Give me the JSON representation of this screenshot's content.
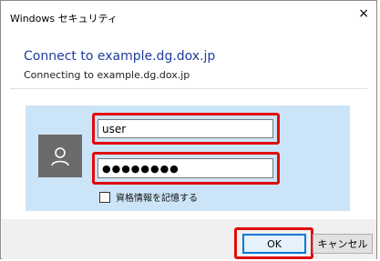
{
  "window": {
    "title": "Windows セキュリティ",
    "close_glyph": "×"
  },
  "header": {
    "heading": "Connect to example.dg.dox.jp",
    "subheading": "Connecting to example.dg.dox.jp"
  },
  "credentials": {
    "username_value": "user",
    "password_value": "●●●●●●●●",
    "remember_label": "資格情報を記憶する",
    "avatar_icon": "user-icon"
  },
  "buttons": {
    "ok_label": "OK",
    "cancel_label": "キャンセル"
  },
  "colors": {
    "heading": "#1f3d9c",
    "panel": "#cce4f7",
    "highlight": "#e10c0c",
    "ok_border": "#0078d7"
  }
}
